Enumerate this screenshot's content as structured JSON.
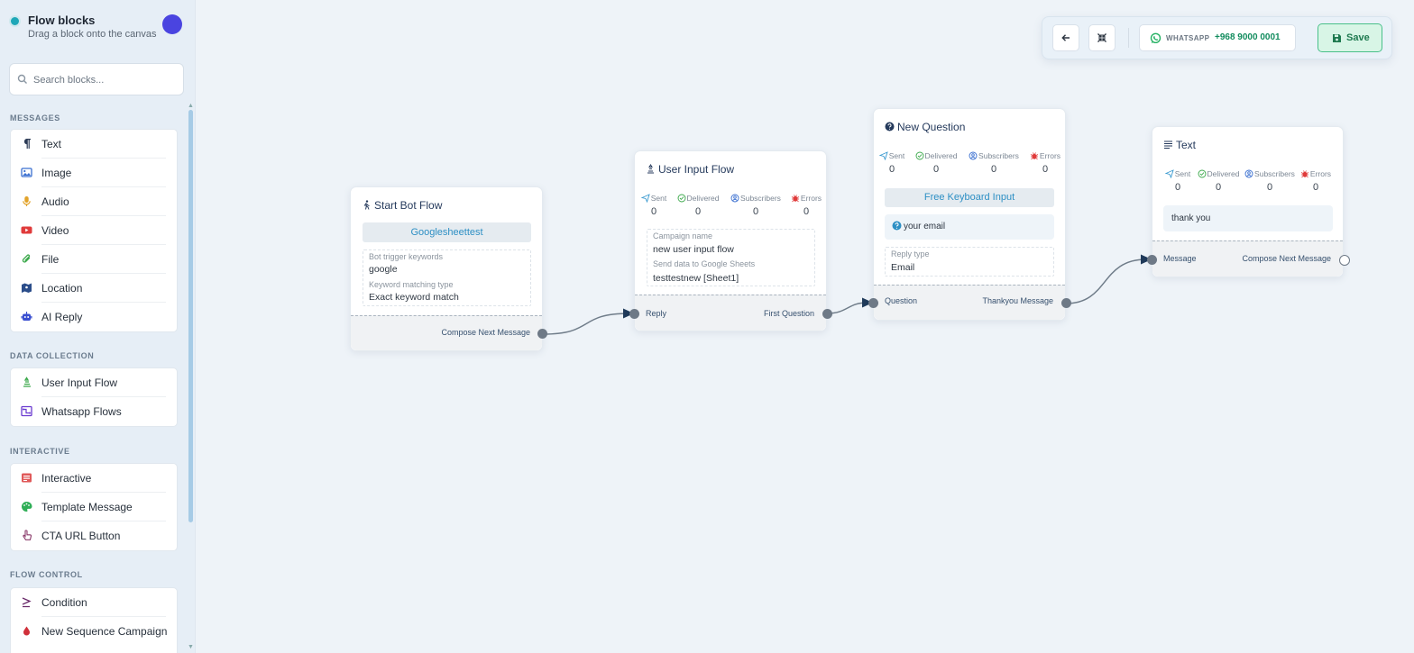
{
  "sidebar": {
    "title": "Flow blocks",
    "subtitle": "Drag a block onto the canvas",
    "search_placeholder": "Search blocks...",
    "sections": {
      "messages": {
        "label": "MESSAGES",
        "items": [
          {
            "label": "Text",
            "icon": "paragraph-icon",
            "color": "#2b3a55"
          },
          {
            "label": "Image",
            "icon": "image-icon",
            "color": "#3a6fd0"
          },
          {
            "label": "Audio",
            "icon": "microphone-icon",
            "color": "#e2a32a"
          },
          {
            "label": "Video",
            "icon": "youtube-icon",
            "color": "#e03b3b"
          },
          {
            "label": "File",
            "icon": "paperclip-icon",
            "color": "#3aa84a"
          },
          {
            "label": "Location",
            "icon": "map-icon",
            "color": "#2b4d8a"
          },
          {
            "label": "AI Reply",
            "icon": "robot-icon",
            "color": "#3a4fd0"
          }
        ]
      },
      "data_collection": {
        "label": "DATA COLLECTION",
        "items": [
          {
            "label": "User Input Flow",
            "icon": "form-icon",
            "color": "#3aa84a"
          },
          {
            "label": "Whatsapp Flows",
            "icon": "flows-icon",
            "color": "#6a3ad0"
          }
        ]
      },
      "interactive": {
        "label": "INTERACTIVE",
        "items": [
          {
            "label": "Interactive",
            "icon": "list-card-icon",
            "color": "#e05a5a"
          },
          {
            "label": "Template Message",
            "icon": "palette-icon",
            "color": "#2fae56"
          },
          {
            "label": "CTA URL Button",
            "icon": "pointer-hand-icon",
            "color": "#8a3a6a"
          }
        ]
      },
      "flow_control": {
        "label": "FLOW CONTROL",
        "items": [
          {
            "label": "Condition",
            "icon": "greater-equal-icon",
            "color": "#6a2a6a"
          },
          {
            "label": "New Sequence Campaign",
            "icon": "droplet-icon",
            "color": "#d0303a"
          }
        ]
      }
    }
  },
  "toolbar": {
    "whatsapp_label": "WHATSAPP",
    "phone": "+968 9000 0001",
    "save_label": "Save",
    "accent_save": "#49c089"
  },
  "stat_labels": {
    "sent": "Sent",
    "delivered": "Delivered",
    "subscribers": "Subscribers",
    "errors": "Errors"
  },
  "nodes": {
    "start": {
      "title": "Start Bot Flow",
      "chip": "Googlesheettest",
      "keywords_label": "Bot trigger keywords",
      "keywords_value": "google",
      "match_label": "Keyword matching type",
      "match_value": "Exact keyword match",
      "out_port": "Compose Next Message"
    },
    "user_input": {
      "title": "User Input Flow",
      "stats": {
        "sent": "0",
        "delivered": "0",
        "subscribers": "0",
        "errors": "0"
      },
      "campaign_label": "Campaign name",
      "campaign_value": "new user input flow",
      "sheets_label": "Send data to Google Sheets",
      "sheets_value": "testtestnew [Sheet1]",
      "in_port": "Reply",
      "out_port": "First Question"
    },
    "question": {
      "title": "New Question",
      "stats": {
        "sent": "0",
        "delivered": "0",
        "subscribers": "0",
        "errors": "0"
      },
      "chip": "Free Keyboard Input",
      "message": "your email",
      "reply_label": "Reply type",
      "reply_value": "Email",
      "in_port": "Question",
      "out_port": "Thankyou Message"
    },
    "text": {
      "title": "Text",
      "stats": {
        "sent": "0",
        "delivered": "0",
        "subscribers": "0",
        "errors": "0"
      },
      "message": "thank you",
      "in_port": "Message",
      "out_port": "Compose Next Message"
    }
  }
}
